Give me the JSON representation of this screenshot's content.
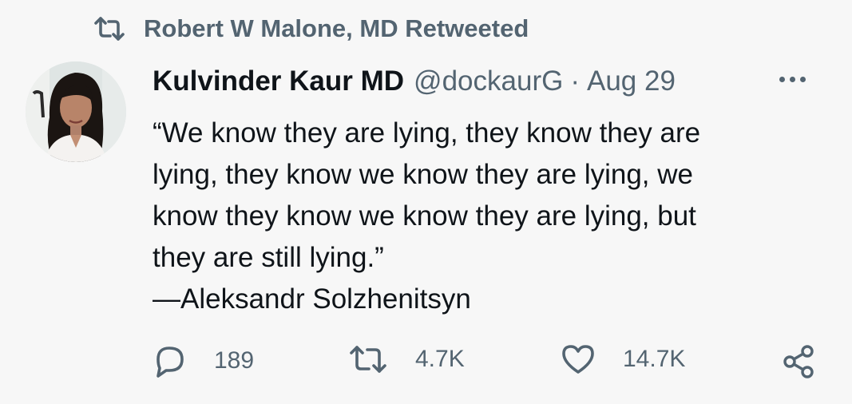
{
  "social_context": {
    "icon": "retweet-icon",
    "text": "Robert W Malone, MD Retweeted"
  },
  "tweet": {
    "author": {
      "display_name": "Kulvinder Kaur MD",
      "handle": "@dockaurG",
      "avatar_icon": "profile-photo"
    },
    "separator": "·",
    "date": "Aug 29",
    "more_icon": "more-dots-icon",
    "text_lines": [
      "“We know they are lying, they know they are",
      "lying, they know we know they are lying, we",
      "know they know we know they are lying, but",
      "they are still lying.”",
      "—Aleksandr Solzhenitsyn"
    ]
  },
  "actions": {
    "reply": {
      "icon": "reply-icon",
      "count": "189"
    },
    "retweet": {
      "icon": "retweet-icon",
      "count": "4.7K"
    },
    "like": {
      "icon": "heart-icon",
      "count": "14.7K"
    },
    "share": {
      "icon": "share-icon"
    }
  },
  "colors": {
    "background": "#f7f7f7",
    "primary_text": "#0f1419",
    "secondary_text": "#536471"
  }
}
